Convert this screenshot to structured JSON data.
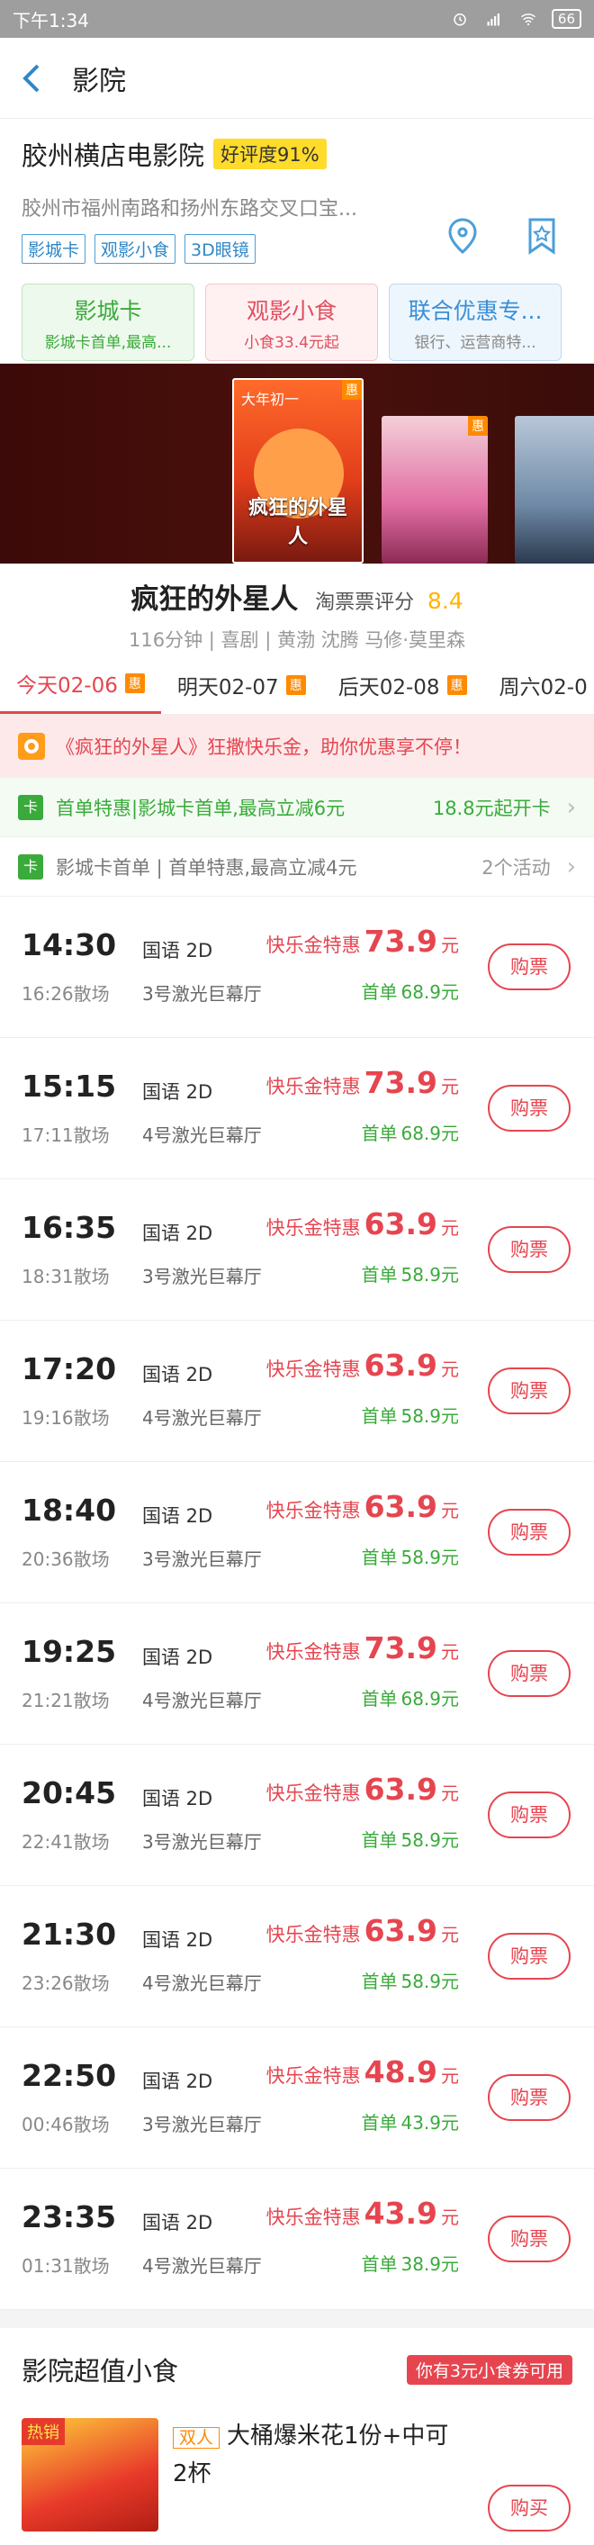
{
  "status_bar": {
    "time": "下午1:34",
    "battery": "66"
  },
  "nav": {
    "title": "影院"
  },
  "cinema": {
    "name": "胶州横店电影院",
    "rating": "好评度91%",
    "address": "胶州市福州南路和扬州东路交叉口宝...",
    "tags": [
      "影城卡",
      "观影小食",
      "3D眼镜"
    ],
    "cards": [
      {
        "title": "影城卡",
        "subtitle": "影城卡首单,最高...",
        "color": "#3aaa3a"
      },
      {
        "title": "观影小食",
        "subtitle": "小食33.4元起",
        "color": "#e04f5f"
      },
      {
        "title": "联合优惠专...",
        "subtitle": "银行、运营商特...",
        "color": "#3a8fd6"
      }
    ]
  },
  "posters": {
    "main_caption": "疯狂的外星人",
    "main_top": "大年初一",
    "badge": "惠"
  },
  "movie": {
    "title": "疯狂的外星人",
    "score_label": "淘票票评分",
    "score": "8.4",
    "meta": "116分钟 | 喜剧 | 黄渤 沈腾 马修·莫里森"
  },
  "date_tabs": [
    {
      "label": "今天02-06",
      "badge": "惠"
    },
    {
      "label": "明天02-07",
      "badge": "惠"
    },
    {
      "label": "后天02-08",
      "badge": "惠"
    },
    {
      "label": "周六02-0",
      "badge": ""
    }
  ],
  "promo_banner": {
    "text": "《疯狂的外星人》狂撒快乐金，助你优惠享不停！"
  },
  "offers": [
    {
      "icon": "卡",
      "text": "首单特惠|影城卡首单,最高立减6元",
      "right": "18.8元起开卡"
    },
    {
      "icon": "卡",
      "text": "影城卡首单 | 首单特惠,最高立减4元",
      "right": "2个活动"
    }
  ],
  "showtimes": [
    {
      "start": "14:30",
      "end": "16:26散场",
      "lang": "国语 2D",
      "hall": "3号激光巨幕厅",
      "promo_label": "快乐金特惠",
      "price": "73.9",
      "yuan": "元",
      "first_label": "首单",
      "first_price": "68.9元",
      "buy": "购票"
    },
    {
      "start": "15:15",
      "end": "17:11散场",
      "lang": "国语 2D",
      "hall": "4号激光巨幕厅",
      "promo_label": "快乐金特惠",
      "price": "73.9",
      "yuan": "元",
      "first_label": "首单",
      "first_price": "68.9元",
      "buy": "购票"
    },
    {
      "start": "16:35",
      "end": "18:31散场",
      "lang": "国语 2D",
      "hall": "3号激光巨幕厅",
      "promo_label": "快乐金特惠",
      "price": "63.9",
      "yuan": "元",
      "first_label": "首单",
      "first_price": "58.9元",
      "buy": "购票"
    },
    {
      "start": "17:20",
      "end": "19:16散场",
      "lang": "国语 2D",
      "hall": "4号激光巨幕厅",
      "promo_label": "快乐金特惠",
      "price": "63.9",
      "yuan": "元",
      "first_label": "首单",
      "first_price": "58.9元",
      "buy": "购票"
    },
    {
      "start": "18:40",
      "end": "20:36散场",
      "lang": "国语 2D",
      "hall": "3号激光巨幕厅",
      "promo_label": "快乐金特惠",
      "price": "63.9",
      "yuan": "元",
      "first_label": "首单",
      "first_price": "58.9元",
      "buy": "购票"
    },
    {
      "start": "19:25",
      "end": "21:21散场",
      "lang": "国语 2D",
      "hall": "4号激光巨幕厅",
      "promo_label": "快乐金特惠",
      "price": "73.9",
      "yuan": "元",
      "first_label": "首单",
      "first_price": "68.9元",
      "buy": "购票"
    },
    {
      "start": "20:45",
      "end": "22:41散场",
      "lang": "国语 2D",
      "hall": "3号激光巨幕厅",
      "promo_label": "快乐金特惠",
      "price": "63.9",
      "yuan": "元",
      "first_label": "首单",
      "first_price": "58.9元",
      "buy": "购票"
    },
    {
      "start": "21:30",
      "end": "23:26散场",
      "lang": "国语 2D",
      "hall": "4号激光巨幕厅",
      "promo_label": "快乐金特惠",
      "price": "63.9",
      "yuan": "元",
      "first_label": "首单",
      "first_price": "58.9元",
      "buy": "购票"
    },
    {
      "start": "22:50",
      "end": "00:46散场",
      "lang": "国语 2D",
      "hall": "3号激光巨幕厅",
      "promo_label": "快乐金特惠",
      "price": "48.9",
      "yuan": "元",
      "first_label": "首单",
      "first_price": "43.9元",
      "buy": "购票"
    },
    {
      "start": "23:35",
      "end": "01:31散场",
      "lang": "国语 2D",
      "hall": "4号激光巨幕厅",
      "promo_label": "快乐金特惠",
      "price": "43.9",
      "yuan": "元",
      "first_label": "首单",
      "first_price": "38.9元",
      "buy": "购票"
    }
  ],
  "snacks": {
    "title": "影院超值小食",
    "coupon": "你有3元小食券可用",
    "item": {
      "hot": "热销",
      "badge": "双人",
      "name": "大桶爆米花1份+中可2杯",
      "buy": "购买"
    }
  },
  "colors": {
    "accent": "#e6454f",
    "green": "#3aaa3a",
    "orange": "#ff8a00",
    "blue": "#2f87c7"
  }
}
